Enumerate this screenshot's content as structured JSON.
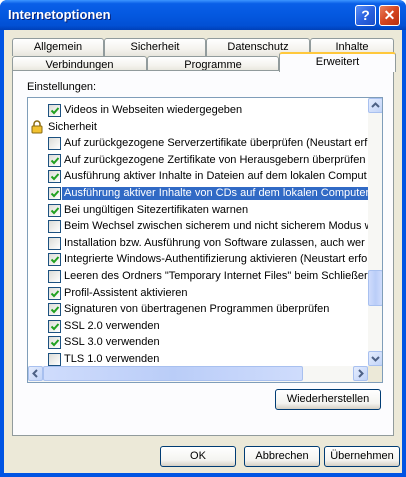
{
  "window": {
    "title": "Internetoptionen",
    "help_glyph": "?",
    "close_glyph": "✕"
  },
  "tabs_row1": [
    "Allgemein",
    "Sicherheit",
    "Datenschutz",
    "Inhalte"
  ],
  "tabs_row2": [
    "Verbindungen",
    "Programme",
    "Erweitert"
  ],
  "active_tab": "Erweitert",
  "settings_label": "Einstellungen:",
  "items": [
    {
      "label": "Videos in Webseiten wiedergegeben",
      "checked": true
    },
    {
      "label": "Sicherheit",
      "group": true
    },
    {
      "label": "Auf zurückgezogene Serverzertifikate überprüfen (Neustart erf",
      "checked": false
    },
    {
      "label": "Auf zurückgezogene Zertifikate von Herausgebern überprüfen",
      "checked": true
    },
    {
      "label": "Ausführung aktiver Inhalte in Dateien auf dem lokalen Comput",
      "checked": true
    },
    {
      "label": "Ausführung aktiver Inhalte von CDs auf dem lokalen Computer",
      "checked": true,
      "selected": true
    },
    {
      "label": "Bei ungültigen Sitezertifikaten warnen",
      "checked": true
    },
    {
      "label": "Beim Wechsel zwischen sicherem und nicht sicherem Modus w",
      "checked": false
    },
    {
      "label": "Installation bzw. Ausführung von Software zulassen, auch wer",
      "checked": false
    },
    {
      "label": "Integrierte Windows-Authentifizierung aktivieren (Neustart erfor",
      "checked": true
    },
    {
      "label": "Leeren des Ordners \"Temporary Internet Files\" beim Schließer",
      "checked": false
    },
    {
      "label": "Profil-Assistent aktivieren",
      "checked": true
    },
    {
      "label": "Signaturen von übertragenen Programmen überprüfen",
      "checked": true
    },
    {
      "label": "SSL 2.0 verwenden",
      "checked": true
    },
    {
      "label": "SSL 3.0 verwenden",
      "checked": true
    },
    {
      "label": "TLS 1.0 verwenden",
      "checked": false
    }
  ],
  "restore_button": "Wiederherstellen",
  "ok_button": "OK",
  "cancel_button": "Abbrechen",
  "apply_button": "Übernehmen",
  "icons": {
    "lock": "lock-icon",
    "check": "checkmark-icon"
  },
  "colors": {
    "titlebar": "#0458e0",
    "selection": "#316ac5",
    "check": "#21a121",
    "face": "#ece9d8"
  }
}
